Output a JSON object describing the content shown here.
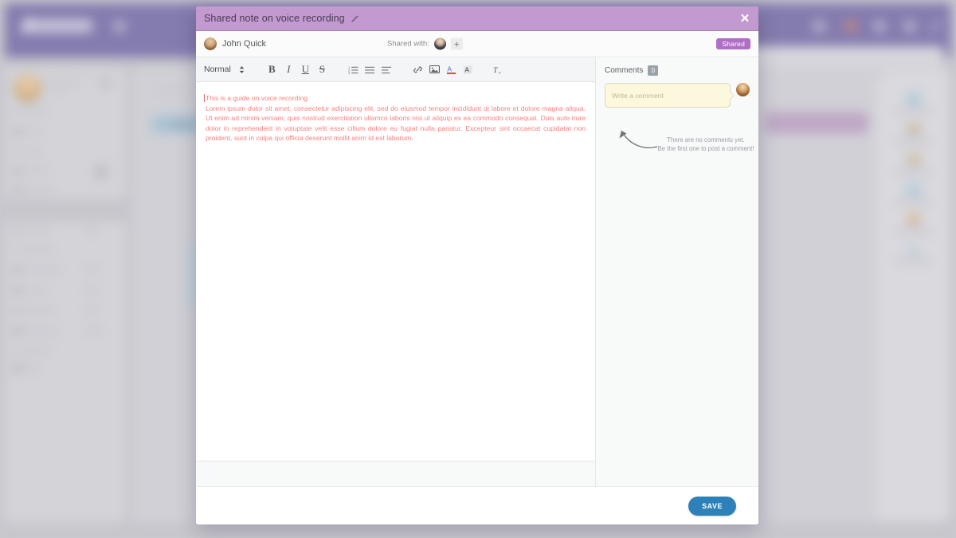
{
  "background_app": {
    "topbar_color": "#847cae",
    "logo_label": "",
    "icons": [
      "search-icon",
      "notification-icon",
      "grid-icon",
      "apps-icon",
      "edit-icon"
    ]
  },
  "modal": {
    "title": "Shared note on voice recording",
    "title_edit_icon": "pencil-icon",
    "close_icon": "close-icon",
    "owner": {
      "name": "John Quick",
      "avatar": "user-avatar"
    },
    "shared_with": {
      "label": "Shared with:",
      "avatars": [
        "shared-user-avatar"
      ],
      "add_label": "+"
    },
    "status_badge": "Shared",
    "accent_color": "#c29ad0",
    "badge_color": "#b06fc6"
  },
  "editor": {
    "toolbar": {
      "style_select": "Normal",
      "buttons": [
        {
          "name": "bold-icon",
          "label": "B"
        },
        {
          "name": "italic-icon",
          "label": "I"
        },
        {
          "name": "underline-icon",
          "label": "U"
        },
        {
          "name": "strikethrough-icon",
          "label": "S"
        },
        {
          "name": "ordered-list-icon",
          "label": ""
        },
        {
          "name": "unordered-list-icon",
          "label": ""
        },
        {
          "name": "align-icon",
          "label": ""
        },
        {
          "name": "link-icon",
          "label": ""
        },
        {
          "name": "image-icon",
          "label": ""
        },
        {
          "name": "text-color-icon",
          "label": "A"
        },
        {
          "name": "highlight-color-icon",
          "label": "A"
        },
        {
          "name": "clear-format-icon",
          "label": "Tx"
        }
      ]
    },
    "content": {
      "heading": "This is a guide on voice recording",
      "paragraph": "Lorem ipsum dolor sit amet, consectetur adipiscing elit, sed do eiusmod tempor incididunt ut labore et dolore magna aliqua. Ut enim ad minim veniam, quis nostrud exercitation ullamco laboris nisi ut aliquip ex ea commodo consequat. Duis aute irure dolor in reprehenderit in voluptate velit esse cillum dolore eu fugiat nulla pariatur. Excepteur sint occaecat cupidatat non proident, sunt in culpa qui officia deserunt mollit anim id est laborum.",
      "text_color": "#fb8080"
    }
  },
  "comments": {
    "title": "Comments",
    "count": "0",
    "input_placeholder": "Write a comment",
    "input_value": "",
    "empty_line1": "There are no comments yet.",
    "empty_line2": "Be the first one to post a comment!",
    "avatar": "commenter-avatar"
  },
  "footer": {
    "save_label": "SAVE",
    "save_color": "#2e81b8"
  }
}
